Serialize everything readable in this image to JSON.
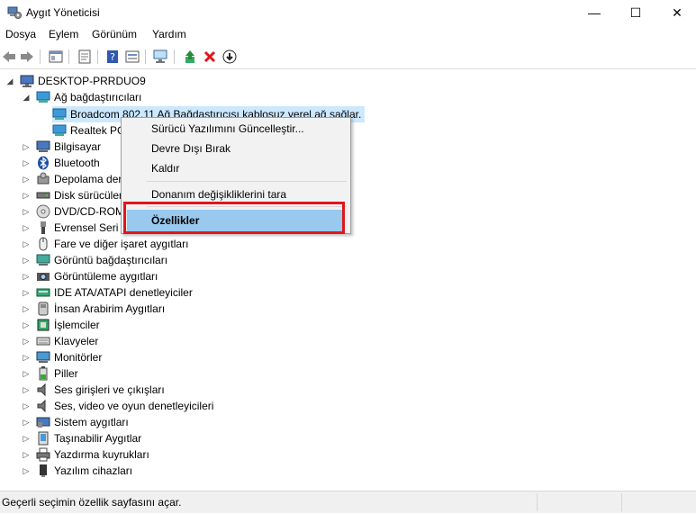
{
  "window": {
    "title": "Aygıt Yöneticisi",
    "minimize": "—",
    "maximize": "☐",
    "close": "✕"
  },
  "menu": [
    "Dosya",
    "Eylem",
    "Görünüm",
    "Yardım"
  ],
  "tree": {
    "root": "DESKTOP-PRRDUO9",
    "network_group": "Ağ bağdaştırıcıları",
    "network_children": [
      "Broadcom 802.11 Ağ Bağdaştırıcısı kablosuz yerel ağ sağlar.",
      "Realtek PC"
    ],
    "categories": [
      "Bilgisayar",
      "Bluetooth",
      "Depolama der",
      "Disk sürücüler",
      "DVD/CD-ROM",
      "Evrensel Seri V",
      "Fare ve diğer işaret aygıtları",
      "Görüntü bağdaştırıcıları",
      "Görüntüleme aygıtları",
      "IDE ATA/ATAPI denetleyiciler",
      "İnsan Arabirim Aygıtları",
      "İşlemciler",
      "Klavyeler",
      "Monitörler",
      "Piller",
      "Ses girişleri ve çıkışları",
      "Ses, video ve oyun denetleyicileri",
      "Sistem aygıtları",
      "Taşınabilir Aygıtlar",
      "Yazdırma kuyrukları",
      "Yazılım cihazları"
    ]
  },
  "context_menu": {
    "items": [
      "Sürücü Yazılımını Güncelleştir...",
      "Devre Dışı Bırak",
      "Kaldır",
      "Donanım değişikliklerini tara"
    ],
    "highlighted": "Özellikler"
  },
  "status": "Geçerli seçimin özellik sayfasını açar.",
  "colors": {
    "selection": "#cce8ff",
    "menu_highlight": "#99c9ef",
    "callout": "#e0161b"
  }
}
